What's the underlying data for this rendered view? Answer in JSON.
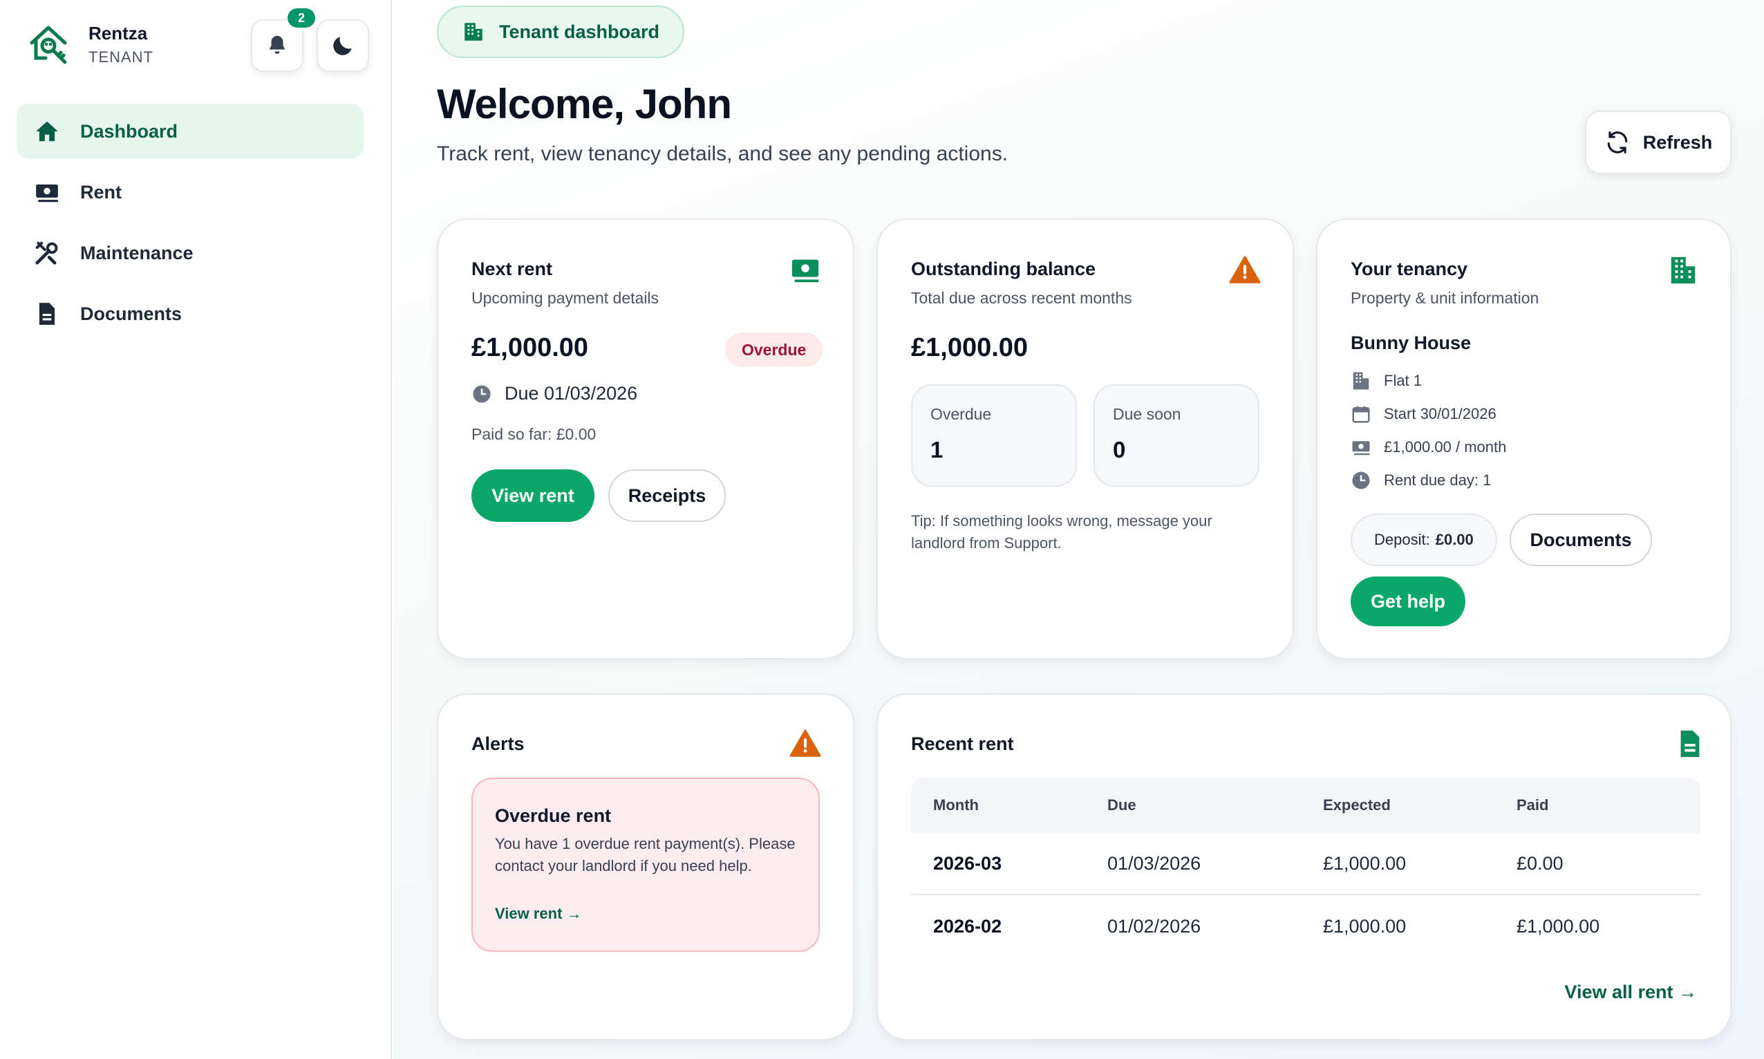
{
  "brand": {
    "name": "Rentza",
    "role": "TENANT"
  },
  "notifications": {
    "count": "2"
  },
  "nav": {
    "items": [
      {
        "label": "Dashboard",
        "icon": "home-icon",
        "active": true
      },
      {
        "label": "Rent",
        "icon": "money-icon"
      },
      {
        "label": "Maintenance",
        "icon": "tools-icon"
      },
      {
        "label": "Documents",
        "icon": "document-icon"
      }
    ]
  },
  "header": {
    "chip": "Tenant dashboard",
    "welcome": "Welcome, John",
    "subtitle": "Track rent, view tenancy details, and see any pending actions.",
    "refresh": "Refresh"
  },
  "next_rent": {
    "title": "Next rent",
    "subtitle": "Upcoming payment details",
    "amount": "£1,000.00",
    "status": "Overdue",
    "due": "Due 01/03/2026",
    "paid_so_far": "Paid so far: £0.00",
    "view_rent": "View rent",
    "receipts": "Receipts"
  },
  "outstanding": {
    "title": "Outstanding balance",
    "subtitle": "Total due across recent months",
    "amount": "£1,000.00",
    "overdue_label": "Overdue",
    "overdue_value": "1",
    "due_soon_label": "Due soon",
    "due_soon_value": "0",
    "tip": "Tip: If something looks wrong, message your landlord from Support."
  },
  "tenancy": {
    "title": "Your tenancy",
    "subtitle": "Property & unit information",
    "property": "Bunny House",
    "unit": "Flat 1",
    "start": "Start 30/01/2026",
    "rent": "£1,000.00 / month",
    "due_day": "Rent due day: 1",
    "deposit_label": "Deposit:",
    "deposit_value": "£0.00",
    "documents": "Documents",
    "get_help": "Get help"
  },
  "alerts": {
    "title": "Alerts",
    "item_title": "Overdue rent",
    "item_text": "You have 1 overdue rent payment(s). Please contact your landlord if you need help.",
    "item_link": "View rent →"
  },
  "recent_rent": {
    "title": "Recent rent",
    "columns": [
      "Month",
      "Due",
      "Expected",
      "Paid"
    ],
    "rows": [
      [
        "2026-03",
        "01/03/2026",
        "£1,000.00",
        "£0.00"
      ],
      [
        "2026-02",
        "01/02/2026",
        "£1,000.00",
        "£1,000.00"
      ]
    ],
    "view_all": "View all rent →"
  },
  "colors": {
    "accent": "#0aa76b",
    "accent_dark": "#065f46",
    "warning": "#d9620b",
    "danger_bg": "#fdecef"
  }
}
